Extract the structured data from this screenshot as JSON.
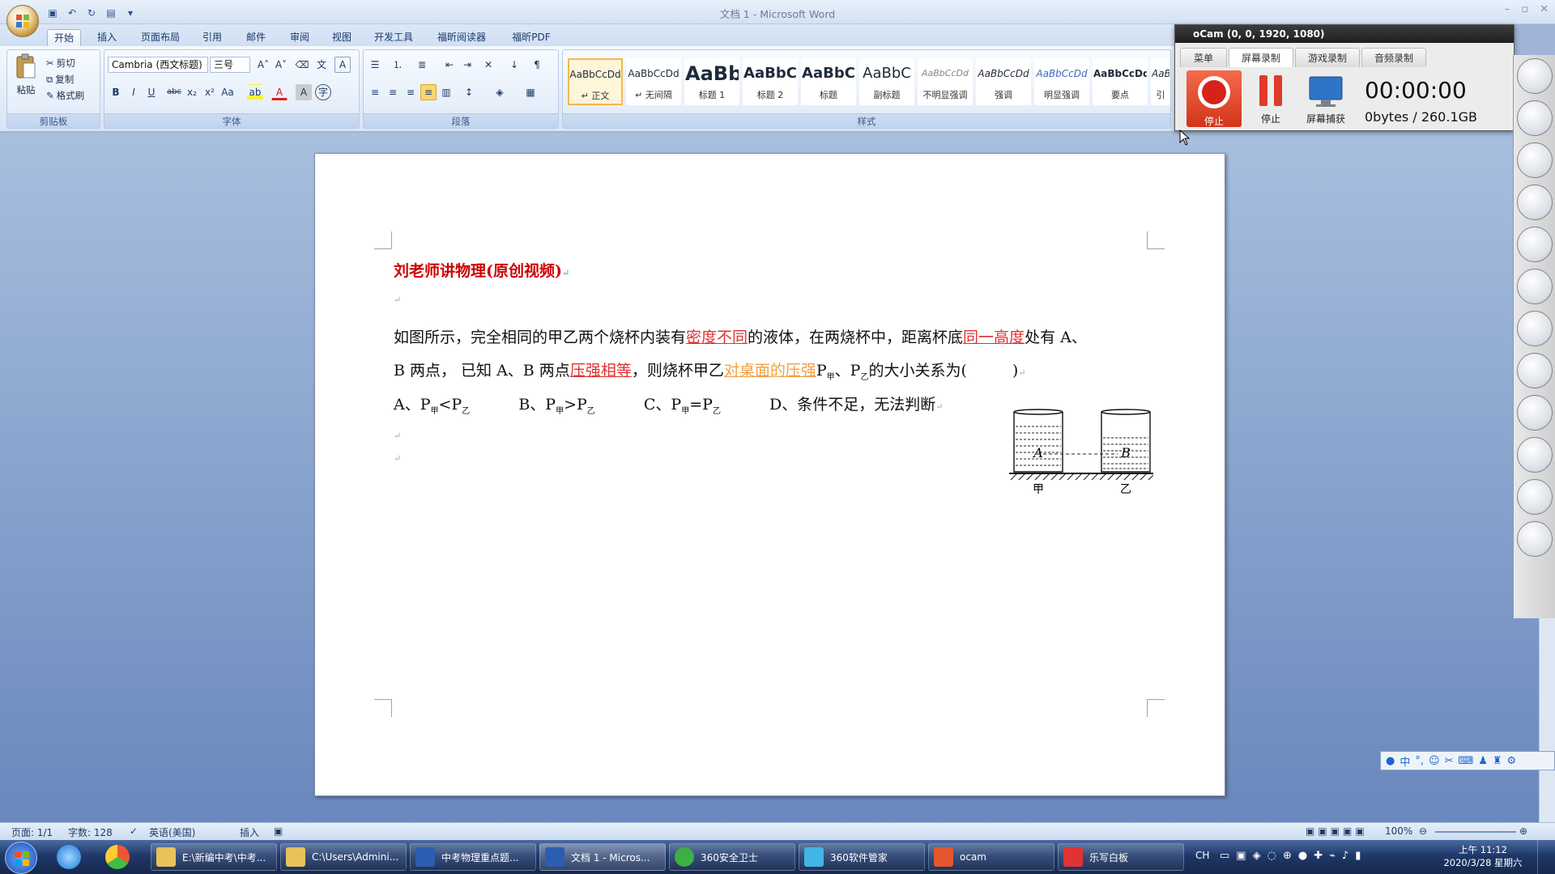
{
  "window": {
    "title": "文档 1 - Microsoft Word"
  },
  "qat": {
    "save": "save-icon",
    "undo": "undo-icon",
    "redo": "redo-icon",
    "print": "print-icon",
    "more": "▾"
  },
  "tabs": [
    {
      "label": "开始",
      "active": true
    },
    {
      "label": "插入"
    },
    {
      "label": "页面布局"
    },
    {
      "label": "引用"
    },
    {
      "label": "邮件"
    },
    {
      "label": "审阅"
    },
    {
      "label": "视图"
    },
    {
      "label": "开发工具"
    },
    {
      "label": "福昕阅读器"
    },
    {
      "label": "福昕PDF"
    }
  ],
  "ribbon": {
    "clipboard": {
      "title": "剪贴板",
      "paste": "粘贴",
      "cut": "剪切",
      "copy": "复制",
      "format_painter": "格式刷"
    },
    "font": {
      "title": "字体",
      "font_name": "Cambria (西文标题)",
      "font_size": "三号"
    },
    "paragraph": {
      "title": "段落"
    },
    "styles": {
      "title": "样式",
      "items": [
        {
          "preview": "AaBbCcDd",
          "name": "↵ 正文",
          "selected": true
        },
        {
          "preview": "AaBbCcDd",
          "name": "↵ 无间隔"
        },
        {
          "preview": "AaBb",
          "name": "标题 1"
        },
        {
          "preview": "AaBbC",
          "name": "标题 2"
        },
        {
          "preview": "AaBbC",
          "name": "标题"
        },
        {
          "preview": "AaBbC",
          "name": "副标题"
        },
        {
          "preview": "AaBbCcDd",
          "name": "不明显强调"
        },
        {
          "preview": "AaBbCcDd",
          "name": "强调"
        },
        {
          "preview": "AaBbCcDd",
          "name": "明显强调"
        },
        {
          "preview": "AaBbCcDd",
          "name": "要点"
        },
        {
          "preview": "AaB",
          "name": "引"
        }
      ]
    }
  },
  "document": {
    "heading": "刘老师讲物理(原创视频)",
    "para1": {
      "t1": "如图所示，完全相同的甲乙两个烧杯内装有",
      "t2": "密度不同",
      "t3": "的液体，在两烧杯中，距离杯底",
      "t4": "同一高度",
      "t5": "处有 A、"
    },
    "para2": {
      "t1": "B 两点， 已知 A、B 两点",
      "t2": "压强相等",
      "t3": "，则烧杯甲乙",
      "t4": "对桌面的压强",
      "t5": "P",
      "s1": "甲",
      "t6": "、P",
      "s2": "乙",
      "t7": "的大小关系为(",
      "t8": ")"
    },
    "options": {
      "a": "A、P",
      "a_s1": "甲",
      "a_rel": "<P",
      "a_s2": "乙",
      "b": "B、P",
      "b_s1": "甲",
      "b_rel": ">P",
      "b_s2": "乙",
      "c": "C、P",
      "c_s1": "甲",
      "c_rel": "=P",
      "c_s2": "乙",
      "d": "D、条件不足，无法判断"
    },
    "figure": {
      "label_left": "甲",
      "label_right": "乙",
      "point_a": "A",
      "point_b": "B"
    }
  },
  "statusbar": {
    "page": "页面: 1/1",
    "words": "字数: 128",
    "language": "英语(美国)",
    "mode": "插入",
    "zoom": "100%"
  },
  "ocam": {
    "title": "oCam (0, 0, 1920, 1080)",
    "tabs": [
      "菜单",
      "屏幕录制",
      "游戏录制",
      "音频录制"
    ],
    "stop": "停止",
    "pause": "停止",
    "capture": "屏幕捕获",
    "timer": "00:00:00",
    "storage": "0bytes / 260.1GB"
  },
  "taskbar": {
    "items": [
      {
        "label": "E:\\新编中考\\中考...",
        "icon": "folder-icon"
      },
      {
        "label": "C:\\Users\\Admini...",
        "icon": "folder-icon"
      },
      {
        "label": "中考物理重点题...",
        "icon": "word-doc-icon"
      },
      {
        "label": "文档 1 - Micros...",
        "icon": "word-doc-icon"
      },
      {
        "label": "360安全卫士",
        "icon": "360-safe-icon"
      },
      {
        "label": "360软件管家",
        "icon": "360-software-icon"
      },
      {
        "label": "ocam",
        "icon": "ocam-icon"
      },
      {
        "label": "乐写白板",
        "icon": "whiteboard-icon"
      }
    ],
    "tray_lang": "CH",
    "time": "上午 11:12",
    "date": "2020/3/28 星期六"
  },
  "ime": {
    "lang": "中"
  },
  "colors": {
    "accent_red": "#e03030",
    "accent_orange": "#f0a040",
    "heading_red": "#cc0000",
    "ribbon_blue": "#dbe7f6"
  }
}
